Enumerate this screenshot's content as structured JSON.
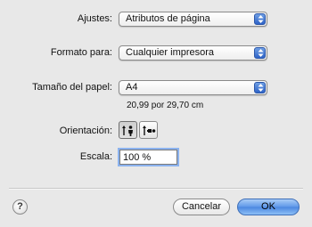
{
  "settings": {
    "label": "Ajustes:",
    "value": "Atributos de página"
  },
  "format": {
    "label": "Formato para:",
    "value": "Cualquier impresora"
  },
  "paper": {
    "label": "Tamaño del papel:",
    "value": "A4",
    "dimensions": "20,99 por 29,70 cm"
  },
  "orientation": {
    "label": "Orientación:",
    "selected": "portrait"
  },
  "scale": {
    "label": "Escala:",
    "value": "100 %"
  },
  "buttons": {
    "help": "?",
    "cancel": "Cancelar",
    "ok": "OK"
  },
  "colors": {
    "accent": "#4a86e0",
    "background": "#e8e8e8"
  }
}
